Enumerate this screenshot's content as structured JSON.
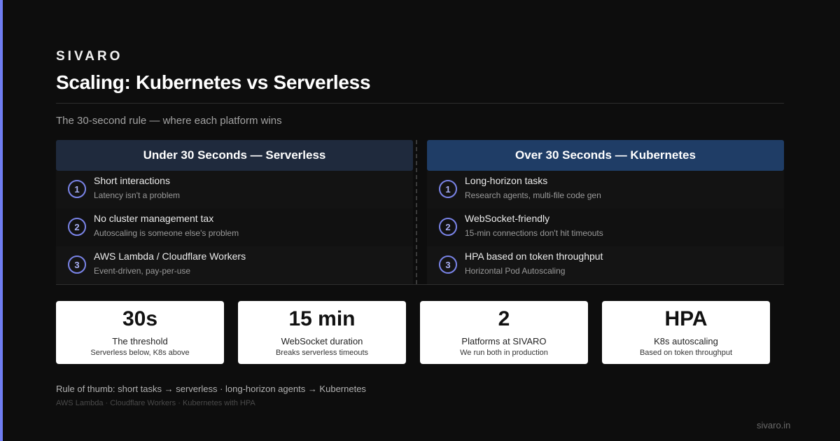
{
  "brand": "SIVARO",
  "title": "Scaling: Kubernetes vs Serverless",
  "subtitle": "The 30-second rule — where each platform wins",
  "columns": [
    {
      "header": "Under 30 Seconds — Serverless",
      "header_color": "#1f2a3d",
      "items": [
        {
          "num": "1",
          "title": "Short interactions",
          "sub": "Latency isn't a problem"
        },
        {
          "num": "2",
          "title": "No cluster management tax",
          "sub": "Autoscaling is someone else's problem"
        },
        {
          "num": "3",
          "title": "AWS Lambda / Cloudflare Workers",
          "sub": "Event-driven, pay-per-use"
        }
      ]
    },
    {
      "header": "Over 30 Seconds — Kubernetes",
      "header_color": "#1f3d66",
      "items": [
        {
          "num": "1",
          "title": "Long-horizon tasks",
          "sub": "Research agents, multi-file code gen"
        },
        {
          "num": "2",
          "title": "WebSocket-friendly",
          "sub": "15-min connections don't hit timeouts"
        },
        {
          "num": "3",
          "title": "HPA based on token throughput",
          "sub": "Horizontal Pod Autoscaling"
        }
      ]
    }
  ],
  "stats": [
    {
      "value": "30s",
      "label": "The threshold",
      "sub": "Serverless below, K8s above"
    },
    {
      "value": "15 min",
      "label": "WebSocket duration",
      "sub": "Breaks serverless timeouts"
    },
    {
      "value": "2",
      "label": "Platforms at SIVARO",
      "sub": "We run both in production"
    },
    {
      "value": "HPA",
      "label": "K8s autoscaling",
      "sub": "Based on token throughput"
    }
  ],
  "footnote": "Rule of thumb: short tasks → serverless · long-horizon agents → Kubernetes",
  "tech": "AWS Lambda · Cloudflare Workers · Kubernetes with HPA",
  "site": "sivaro.in",
  "colors": {
    "accent": "#6f7df2",
    "background": "#0d0d0d"
  }
}
